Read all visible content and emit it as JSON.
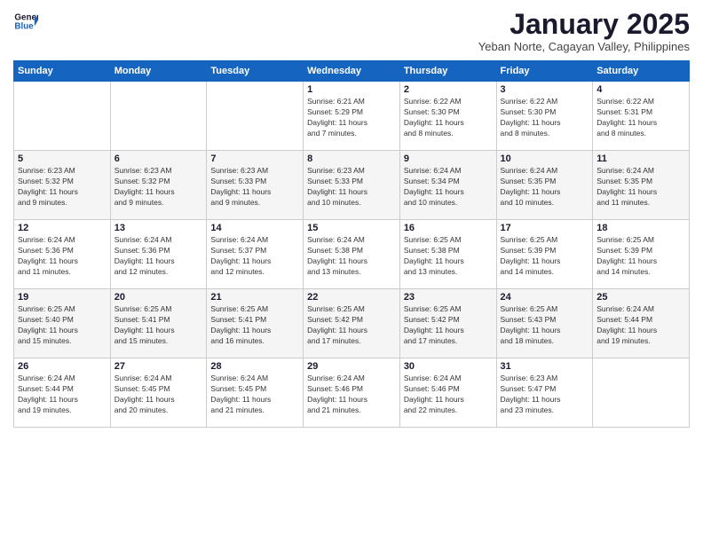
{
  "logo": {
    "line1": "General",
    "line2": "Blue"
  },
  "title": "January 2025",
  "subtitle": "Yeban Norte, Cagayan Valley, Philippines",
  "weekdays": [
    "Sunday",
    "Monday",
    "Tuesday",
    "Wednesday",
    "Thursday",
    "Friday",
    "Saturday"
  ],
  "weeks": [
    [
      {
        "day": "",
        "info": ""
      },
      {
        "day": "",
        "info": ""
      },
      {
        "day": "",
        "info": ""
      },
      {
        "day": "1",
        "info": "Sunrise: 6:21 AM\nSunset: 5:29 PM\nDaylight: 11 hours\nand 7 minutes."
      },
      {
        "day": "2",
        "info": "Sunrise: 6:22 AM\nSunset: 5:30 PM\nDaylight: 11 hours\nand 8 minutes."
      },
      {
        "day": "3",
        "info": "Sunrise: 6:22 AM\nSunset: 5:30 PM\nDaylight: 11 hours\nand 8 minutes."
      },
      {
        "day": "4",
        "info": "Sunrise: 6:22 AM\nSunset: 5:31 PM\nDaylight: 11 hours\nand 8 minutes."
      }
    ],
    [
      {
        "day": "5",
        "info": "Sunrise: 6:23 AM\nSunset: 5:32 PM\nDaylight: 11 hours\nand 9 minutes."
      },
      {
        "day": "6",
        "info": "Sunrise: 6:23 AM\nSunset: 5:32 PM\nDaylight: 11 hours\nand 9 minutes."
      },
      {
        "day": "7",
        "info": "Sunrise: 6:23 AM\nSunset: 5:33 PM\nDaylight: 11 hours\nand 9 minutes."
      },
      {
        "day": "8",
        "info": "Sunrise: 6:23 AM\nSunset: 5:33 PM\nDaylight: 11 hours\nand 10 minutes."
      },
      {
        "day": "9",
        "info": "Sunrise: 6:24 AM\nSunset: 5:34 PM\nDaylight: 11 hours\nand 10 minutes."
      },
      {
        "day": "10",
        "info": "Sunrise: 6:24 AM\nSunset: 5:35 PM\nDaylight: 11 hours\nand 10 minutes."
      },
      {
        "day": "11",
        "info": "Sunrise: 6:24 AM\nSunset: 5:35 PM\nDaylight: 11 hours\nand 11 minutes."
      }
    ],
    [
      {
        "day": "12",
        "info": "Sunrise: 6:24 AM\nSunset: 5:36 PM\nDaylight: 11 hours\nand 11 minutes."
      },
      {
        "day": "13",
        "info": "Sunrise: 6:24 AM\nSunset: 5:36 PM\nDaylight: 11 hours\nand 12 minutes."
      },
      {
        "day": "14",
        "info": "Sunrise: 6:24 AM\nSunset: 5:37 PM\nDaylight: 11 hours\nand 12 minutes."
      },
      {
        "day": "15",
        "info": "Sunrise: 6:24 AM\nSunset: 5:38 PM\nDaylight: 11 hours\nand 13 minutes."
      },
      {
        "day": "16",
        "info": "Sunrise: 6:25 AM\nSunset: 5:38 PM\nDaylight: 11 hours\nand 13 minutes."
      },
      {
        "day": "17",
        "info": "Sunrise: 6:25 AM\nSunset: 5:39 PM\nDaylight: 11 hours\nand 14 minutes."
      },
      {
        "day": "18",
        "info": "Sunrise: 6:25 AM\nSunset: 5:39 PM\nDaylight: 11 hours\nand 14 minutes."
      }
    ],
    [
      {
        "day": "19",
        "info": "Sunrise: 6:25 AM\nSunset: 5:40 PM\nDaylight: 11 hours\nand 15 minutes."
      },
      {
        "day": "20",
        "info": "Sunrise: 6:25 AM\nSunset: 5:41 PM\nDaylight: 11 hours\nand 15 minutes."
      },
      {
        "day": "21",
        "info": "Sunrise: 6:25 AM\nSunset: 5:41 PM\nDaylight: 11 hours\nand 16 minutes."
      },
      {
        "day": "22",
        "info": "Sunrise: 6:25 AM\nSunset: 5:42 PM\nDaylight: 11 hours\nand 17 minutes."
      },
      {
        "day": "23",
        "info": "Sunrise: 6:25 AM\nSunset: 5:42 PM\nDaylight: 11 hours\nand 17 minutes."
      },
      {
        "day": "24",
        "info": "Sunrise: 6:25 AM\nSunset: 5:43 PM\nDaylight: 11 hours\nand 18 minutes."
      },
      {
        "day": "25",
        "info": "Sunrise: 6:24 AM\nSunset: 5:44 PM\nDaylight: 11 hours\nand 19 minutes."
      }
    ],
    [
      {
        "day": "26",
        "info": "Sunrise: 6:24 AM\nSunset: 5:44 PM\nDaylight: 11 hours\nand 19 minutes."
      },
      {
        "day": "27",
        "info": "Sunrise: 6:24 AM\nSunset: 5:45 PM\nDaylight: 11 hours\nand 20 minutes."
      },
      {
        "day": "28",
        "info": "Sunrise: 6:24 AM\nSunset: 5:45 PM\nDaylight: 11 hours\nand 21 minutes."
      },
      {
        "day": "29",
        "info": "Sunrise: 6:24 AM\nSunset: 5:46 PM\nDaylight: 11 hours\nand 21 minutes."
      },
      {
        "day": "30",
        "info": "Sunrise: 6:24 AM\nSunset: 5:46 PM\nDaylight: 11 hours\nand 22 minutes."
      },
      {
        "day": "31",
        "info": "Sunrise: 6:23 AM\nSunset: 5:47 PM\nDaylight: 11 hours\nand 23 minutes."
      },
      {
        "day": "",
        "info": ""
      }
    ]
  ]
}
